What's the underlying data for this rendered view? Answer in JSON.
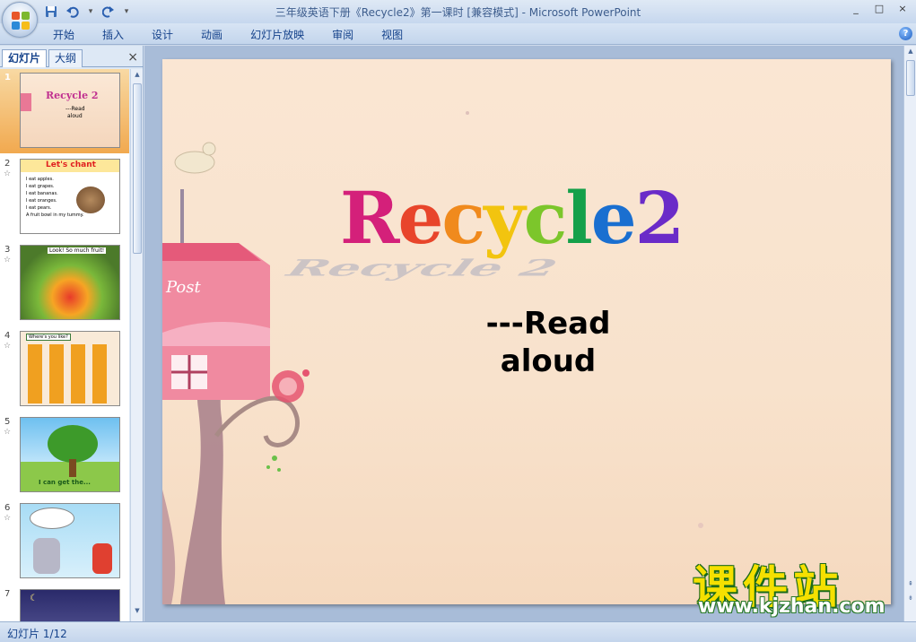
{
  "app": {
    "title": "三年级英语下册《Recycle2》第一课时 [兼容模式] - Microsoft PowerPoint",
    "window_controls": [
      "_",
      "□",
      "×"
    ]
  },
  "quick_access": {
    "save": "save-icon",
    "undo": "undo-icon",
    "redo": "redo-icon",
    "customize": "▾"
  },
  "ribbon": {
    "tabs": [
      "开始",
      "插入",
      "设计",
      "动画",
      "幻灯片放映",
      "审阅",
      "视图"
    ],
    "help": "?"
  },
  "left_panel": {
    "tabs": [
      "幻灯片",
      "大纲"
    ],
    "close": "×",
    "thumbnails": [
      {
        "num": "1",
        "texts": [
          "Recycle 2",
          "---Read",
          "aloud"
        ]
      },
      {
        "num": "2",
        "texts": [
          "Let's chant",
          "I eat apples.",
          "I eat grapes.",
          "I eat bananas.",
          "I eat oranges.",
          "I eat pears.",
          "A fruit bowl in my tummy."
        ]
      },
      {
        "num": "3",
        "texts": [
          "Look! So much fruit!"
        ]
      },
      {
        "num": "4",
        "texts": [
          "Where's you like?"
        ]
      },
      {
        "num": "5",
        "texts": [
          "I can get the..."
        ]
      },
      {
        "num": "6",
        "texts": []
      },
      {
        "num": "7",
        "texts": []
      }
    ]
  },
  "slide": {
    "title_letters": [
      "R",
      "e",
      "c",
      "y",
      "c",
      "l",
      "e",
      " ",
      "2"
    ],
    "title_colors": [
      "#d4207a",
      "#e8452b",
      "#f08a1d",
      "#f2c40f",
      "#7cc62b",
      "#14a04a",
      "#1a6fd0",
      "#ffffff",
      "#6a2bc8"
    ],
    "subtitle_line1": "---Read",
    "subtitle_line2": "aloud",
    "mailbox_text": "Post"
  },
  "status": {
    "slide_indicator": "幻灯片 1/12"
  },
  "watermark": {
    "chinese": "课件站",
    "url": "www.kjzhan.com"
  }
}
